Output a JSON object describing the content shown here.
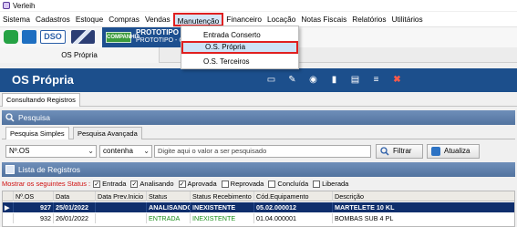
{
  "app": {
    "title": "Verleih"
  },
  "menu": [
    "Sistema",
    "Cadastros",
    "Estoque",
    "Compras",
    "Vendas",
    "Manutenção",
    "Financeiro",
    "Locação",
    "Notas Fiscais",
    "Relatórios",
    "Utilitários"
  ],
  "banner": {
    "badge": "COMPANHIA",
    "line1": "PROTOTIPO PR",
    "line2": "PROTOTIPO - CNP"
  },
  "window_tab": "OS Própria",
  "dropdown": {
    "items": [
      "Entrada Conserto",
      "O.S. Própria",
      "O.S. Terceiros"
    ]
  },
  "form": {
    "title": "OS Própria",
    "subtab": "Consultando Registros"
  },
  "search": {
    "section_title": "Pesquisa",
    "tabs": [
      "Pesquisa Simples",
      "Pesquisa Avançada"
    ],
    "field": "Nº.OS",
    "operator": "contenha",
    "placeholder": "Digite aqui o valor a ser pesquisado",
    "filter_label": "Filtrar",
    "refresh_label": "Atualiza"
  },
  "list": {
    "section_title": "Lista de Registros",
    "status_label": "Mostrar os seguintes Status :",
    "statuses": [
      {
        "label": "Entrada",
        "checked": true
      },
      {
        "label": "Analisando",
        "checked": true
      },
      {
        "label": "Aprovada",
        "checked": true
      },
      {
        "label": "Reprovada",
        "checked": false
      },
      {
        "label": "Concluída",
        "checked": false
      },
      {
        "label": "Liberada",
        "checked": false
      }
    ],
    "columns": [
      "Nº.OS",
      "Data",
      "Data Prev.Inicio",
      "Status",
      "Status Recebimento",
      "Cód.Equipamento",
      "Descrição"
    ],
    "rows": [
      {
        "os": "927",
        "data": "25/01/2022",
        "prev": "",
        "status": "ANALISANDO",
        "receb": "INEXISTENTE",
        "equip": "05.02.000012",
        "desc": "MARTELETE 10 KL",
        "selected": true
      },
      {
        "os": "932",
        "data": "26/01/2022",
        "prev": "",
        "status": "ENTRADA",
        "receb": "INEXISTENTE",
        "equip": "01.04.000001",
        "desc": "BOMBAS SUB 4 PL",
        "selected": false
      }
    ]
  },
  "colors": {
    "header_blue": "#1c4f8c",
    "highlight_red": "#e02020",
    "status_green": "#1a8f1a"
  }
}
